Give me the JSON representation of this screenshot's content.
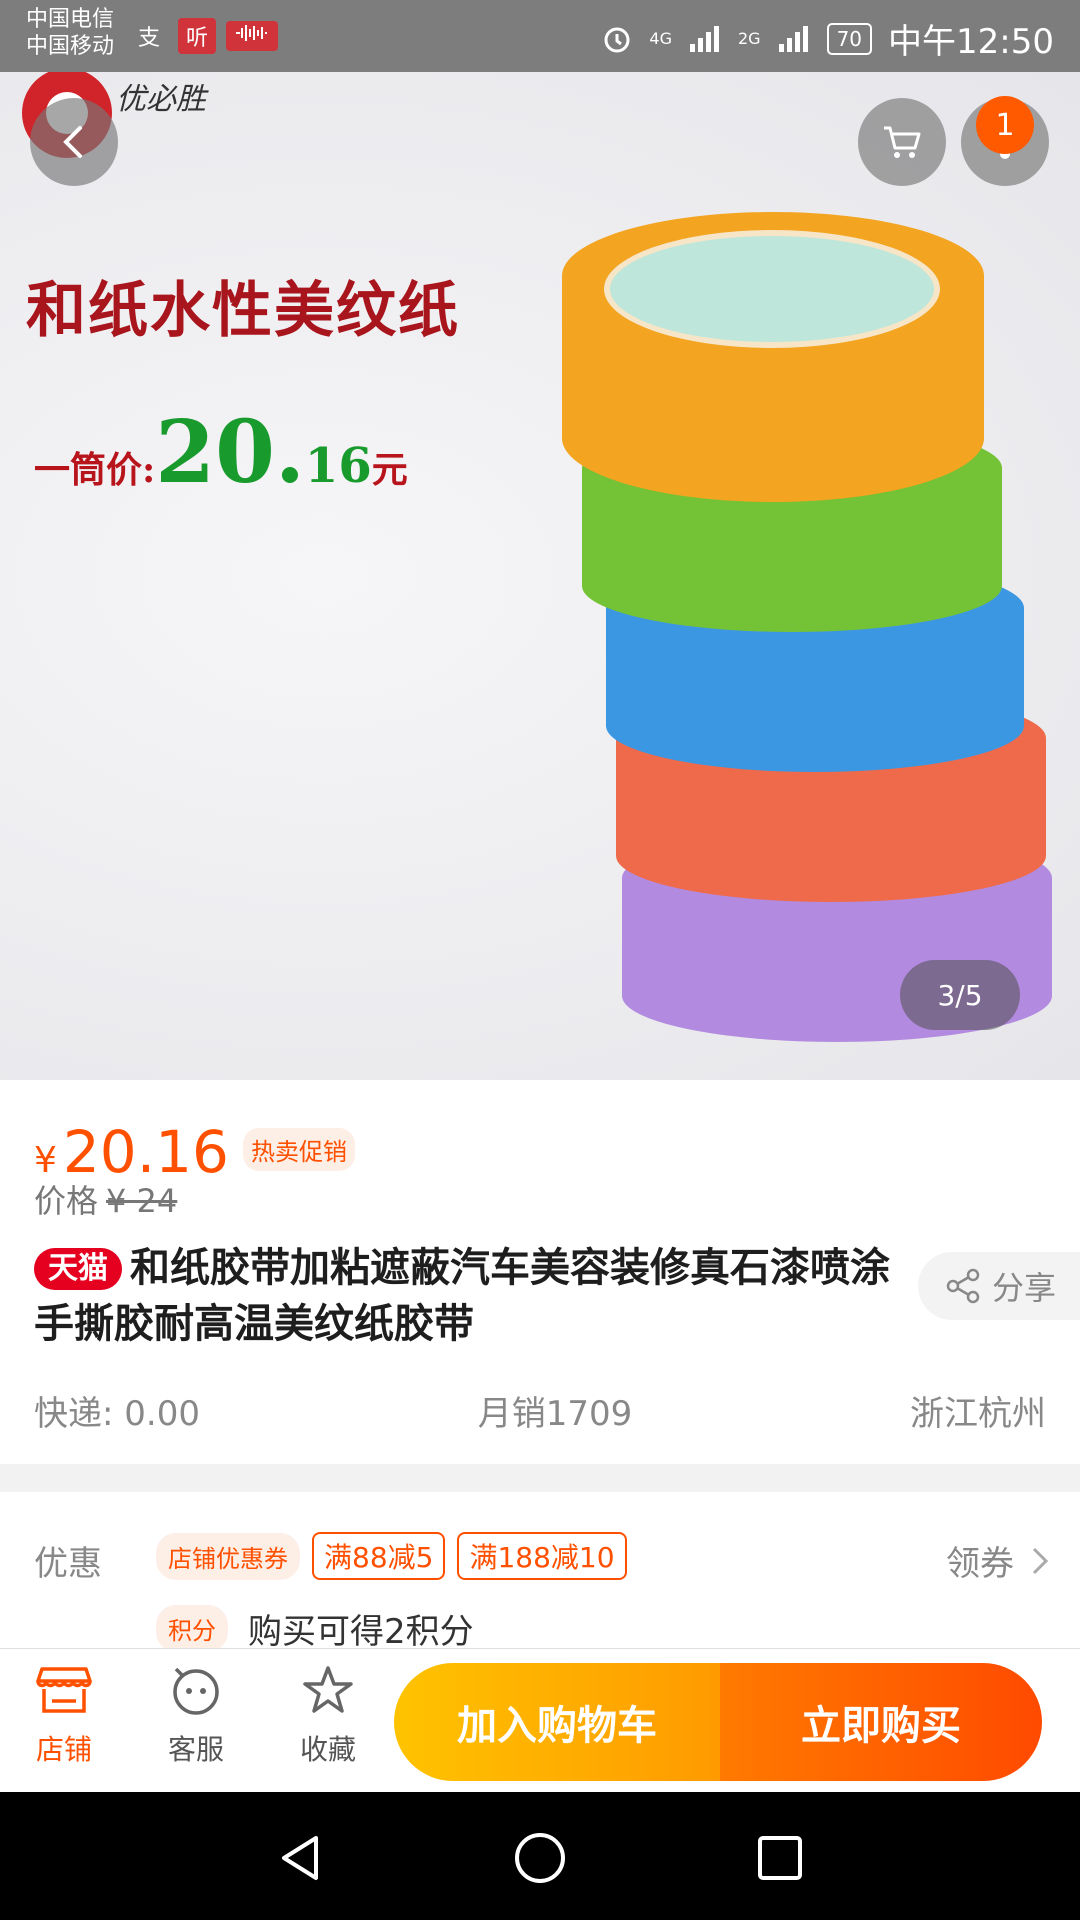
{
  "status_bar": {
    "carrier_1": "中国电信",
    "carrier_2": "中国移动",
    "app_icon_1": "支",
    "app_icon_2": "听",
    "network_1": "4G",
    "network_2": "2G",
    "battery": "70",
    "time": "中午12:50"
  },
  "hero": {
    "brand_name": "优必胜",
    "headline": "和纸水性美纹纸",
    "price_prefix": "一筒价:",
    "price_int": "20.",
    "price_dec": "16",
    "price_unit": "元",
    "cart_badge": "1",
    "image_counter": "3/5",
    "tape_colors": [
      "#f3a421",
      "#74c236",
      "#3c97e3",
      "#ef6a4a",
      "#b28be0"
    ]
  },
  "product": {
    "currency": "¥",
    "price": "20.16",
    "promo_badge": "热卖促销",
    "original_label": "价格",
    "original_price": "¥ 24",
    "tmall_tag": "天猫",
    "title": "和纸胶带加粘遮蔽汽车美容装修真石漆喷涂手撕胶耐高温美纹纸胶带",
    "share_label": "分享",
    "shipping": "快递: 0.00",
    "monthly_sales": "月销1709",
    "location": "浙江杭州"
  },
  "promotions": {
    "label": "优惠",
    "store_coupon": "店铺优惠券",
    "coupon_1": "满88减5",
    "coupon_2": "满188减10",
    "claim_label": "领券",
    "points_tag": "积分",
    "points_text": "购买可得2积分"
  },
  "bottom_bar": {
    "store": "店铺",
    "service": "客服",
    "favorite": "收藏",
    "add_to_cart": "加入购物车",
    "buy_now": "立即购买"
  },
  "colors": {
    "accent": "#ff5000",
    "tmall_red": "#e4001e",
    "cart_button": "#ffb300",
    "buy_button": "#ff5a00"
  }
}
